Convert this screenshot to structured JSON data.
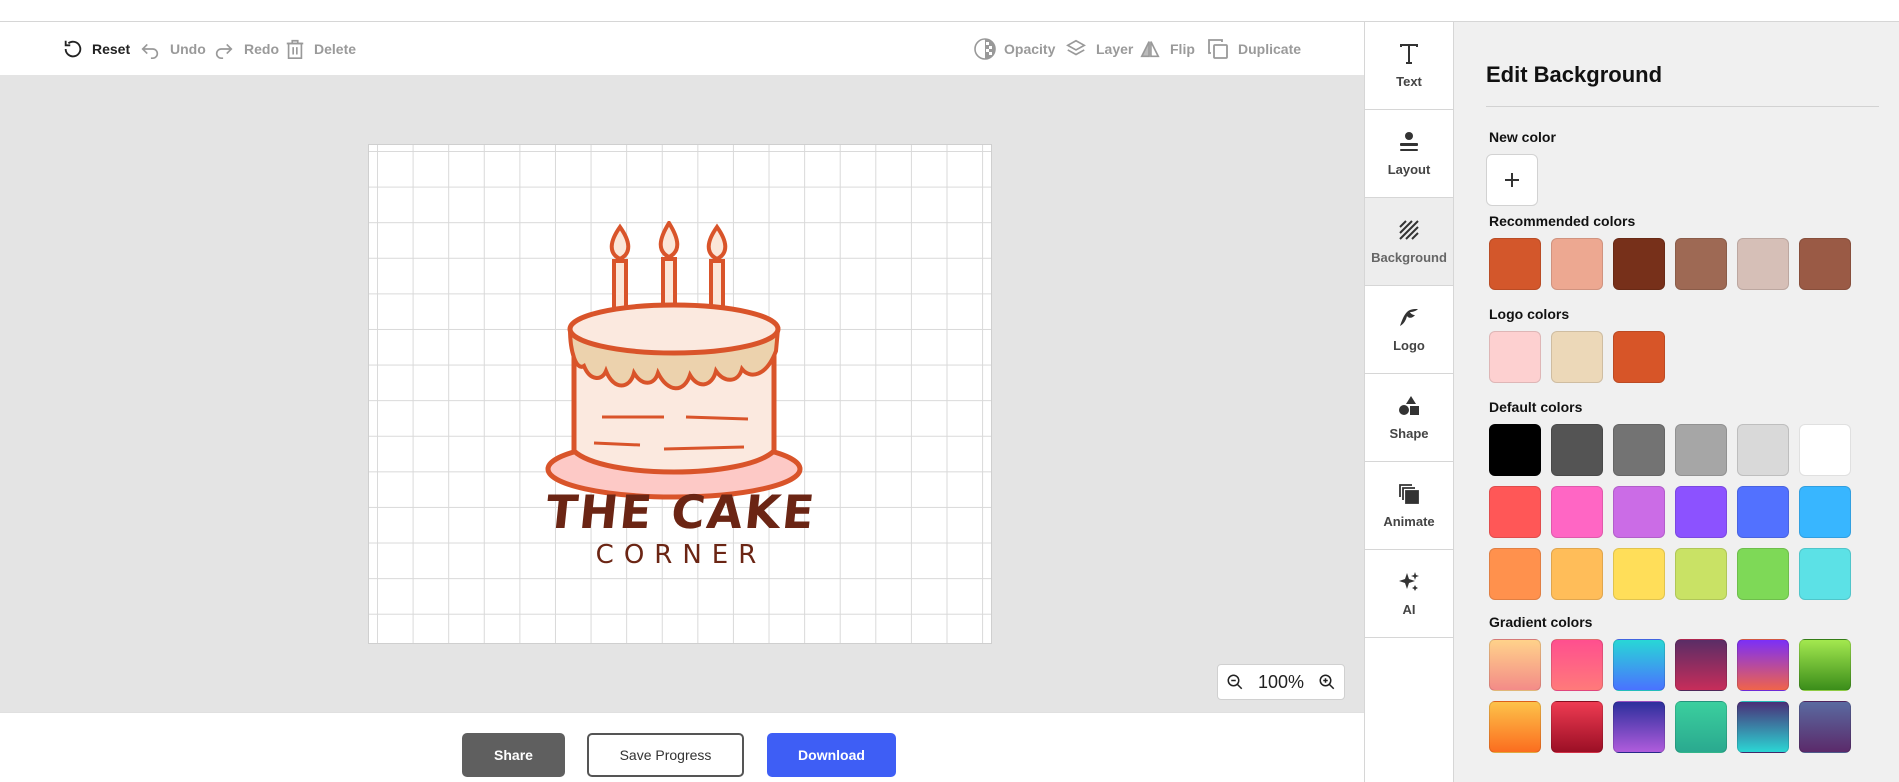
{
  "toolbar": {
    "reset": "Reset",
    "undo": "Undo",
    "redo": "Redo",
    "delete": "Delete",
    "opacity": "Opacity",
    "layer": "Layer",
    "flip": "Flip",
    "duplicate": "Duplicate"
  },
  "canvas": {
    "logo_title": "THE CAKE",
    "logo_subtitle": "CORNER"
  },
  "zoom": {
    "value": "100%"
  },
  "bottom": {
    "share": "Share",
    "save": "Save Progress",
    "download": "Download"
  },
  "rail": [
    {
      "label": "Text",
      "icon": "text-icon"
    },
    {
      "label": "Layout",
      "icon": "layout-icon"
    },
    {
      "label": "Background",
      "icon": "background-icon",
      "active": true
    },
    {
      "label": "Logo",
      "icon": "logo-icon"
    },
    {
      "label": "Shape",
      "icon": "shape-icon"
    },
    {
      "label": "Animate",
      "icon": "animate-icon"
    },
    {
      "label": "AI",
      "icon": "ai-sparkle-icon"
    }
  ],
  "panel": {
    "title": "Edit Background",
    "new_color": "New color",
    "recommended_label": "Recommended colors",
    "recommended": [
      "#d3572b",
      "#eda891",
      "#77301a",
      "#9e6954",
      "#d6bfb7",
      "#9a5a45"
    ],
    "logo_label": "Logo colors",
    "logo": [
      "#fdd0d0",
      "#ecd8b8",
      "#d75528"
    ],
    "default_label": "Default colors",
    "default": [
      [
        "#000000",
        "#545454",
        "#737373",
        "#a6a6a6",
        "#d9d9d9",
        "#ffffff"
      ],
      [
        "#ff5757",
        "#ff66c4",
        "#cb6ce6",
        "#8c52ff",
        "#5271ff",
        "#38b6ff"
      ],
      [
        "#ff914d",
        "#ffbd59",
        "#ffde59",
        "#c9e265",
        "#7ed957",
        "#5ce1e6"
      ]
    ],
    "gradient_label": "Gradient colors",
    "gradients": [
      [
        "linear-gradient(#ffd28a,#f38b88)",
        "linear-gradient(#ff4f8f,#ff7a7a)",
        "linear-gradient(#28d7d6,#4a72ff)",
        "linear-gradient(#5a2d66,#c72d5a)",
        "linear-gradient(#7b2ff7,#f0644a)",
        "linear-gradient(#a3e84f,#3b8d1a)"
      ],
      [
        "linear-gradient(#fdc24a,#fb6d1f)",
        "linear-gradient(#ee3b52,#9b0f25)",
        "linear-gradient(#2c2f9c,#b05cdc)",
        "linear-gradient(#3bcf9e,#2aa98f)",
        "linear-gradient(#4a2f78,#2bd6d4)",
        "linear-gradient(#5a6aa0,#5b2a6a)"
      ]
    ]
  }
}
